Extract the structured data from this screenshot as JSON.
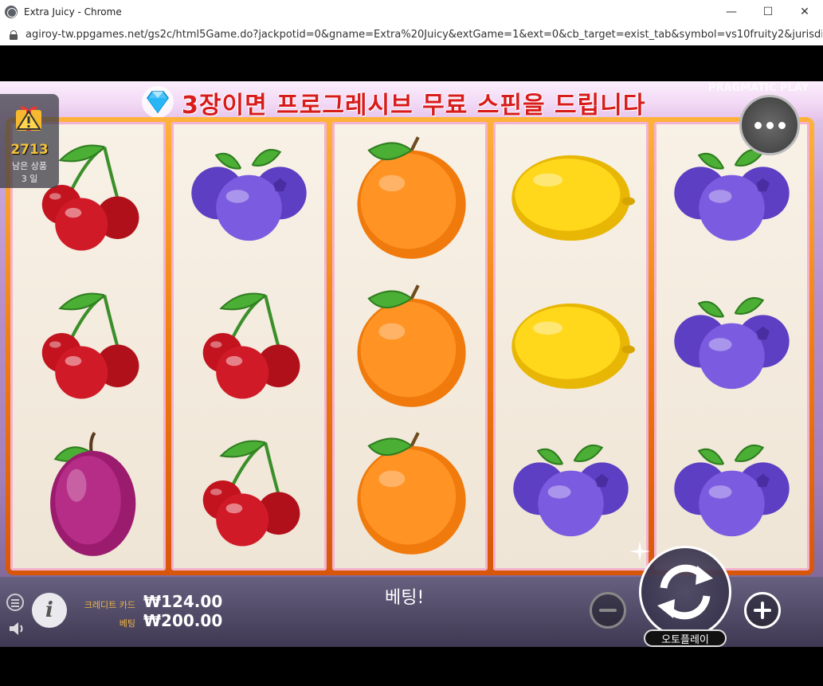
{
  "window": {
    "title": "Extra Juicy - Chrome",
    "minimize": "—",
    "maximize": "☐",
    "close": "✕",
    "url": "agiroy-tw.ppgames.net/gs2c/html5Game.do?jackpotid=0&gname=Extra%20Juicy&extGame=1&ext=0&cb_target=exist_tab&symbol=vs10fruity2&jurisdi..."
  },
  "banner": {
    "text": "3장이면 프로그레시브 무료 스핀을 드립니다",
    "brand": "PRAGMATIC PLAY"
  },
  "gift": {
    "count": "2713",
    "label": "남은 상품",
    "days": "3 일"
  },
  "reels": [
    [
      "cherry",
      "cherry",
      "plum"
    ],
    [
      "blueberry",
      "cherry",
      "cherry"
    ],
    [
      "orange",
      "orange",
      "orange"
    ],
    [
      "lemon",
      "lemon",
      "blueberry"
    ],
    [
      "blueberry",
      "blueberry",
      "blueberry"
    ]
  ],
  "panel": {
    "credit_label": "크레디트 카드",
    "credit_value": "₩124.00",
    "bet_label": "베팅",
    "bet_value": "₩200.00",
    "status": "베팅!",
    "autoplay": "오토플레이",
    "info": "i"
  },
  "colors": {
    "frame": "#f07d10",
    "banner_text": "#d81b1b",
    "gift_count": "#f5c23c"
  }
}
